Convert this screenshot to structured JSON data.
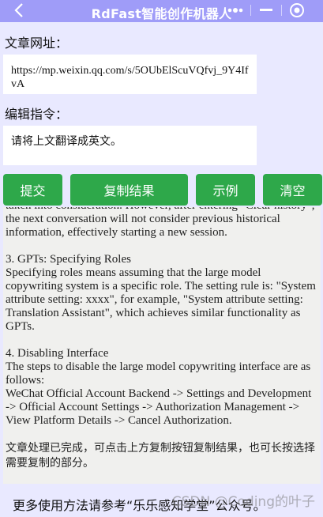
{
  "window": {
    "title": "RdFast智能创作机器人",
    "back_icon": "back-chevron-icon",
    "more_icon": "more-dots-icon",
    "minimize_icon": "minimize-icon",
    "close_icon": "target-circle-icon"
  },
  "form": {
    "url_label": "文章网址：",
    "url_value": "https://mp.weixin.qq.com/s/5OUbElScuVQfvj_9Y4IfvA",
    "command_label": "编辑指令：",
    "command_value": "请将上文翻译成英文。"
  },
  "buttons": {
    "submit": "提交",
    "copy": "复制结果",
    "example": "示例",
    "clear": "清空"
  },
  "output": {
    "paragraphs": [
      "taken into consideration. However, after entering \"Clear history\", the next conversation will not consider previous historical information, effectively starting a new session.",
      "3. GPTs: Specifying Roles\nSpecifying roles means assuming that the large model copywriting system is a specific role. The setting rule is: \"System attribute setting: xxxx\", for example, \"System attribute setting: Translation Assistant\", which achieves similar functionality as GPTs.",
      "4. Disabling Interface\nThe steps to disable the large model copywriting interface are as follows:\nWeChat Official Account Backend -> Settings and Development -> Official Account Settings -> Authorization Management -> View Platform Details -> Cancel Authorization.",
      "文章处理已完成，可点击上方复制按钮复制结果，也可长按选择需要复制的部分。"
    ]
  },
  "footer": {
    "text": "更多使用方法请参考“乐乐感知学堂”公众号。",
    "watermark": "CSDN @Coding的叶子"
  },
  "colors": {
    "titlebar": "#9f9cf8",
    "background": "#e9e9ff",
    "button": "#2ea84a"
  }
}
